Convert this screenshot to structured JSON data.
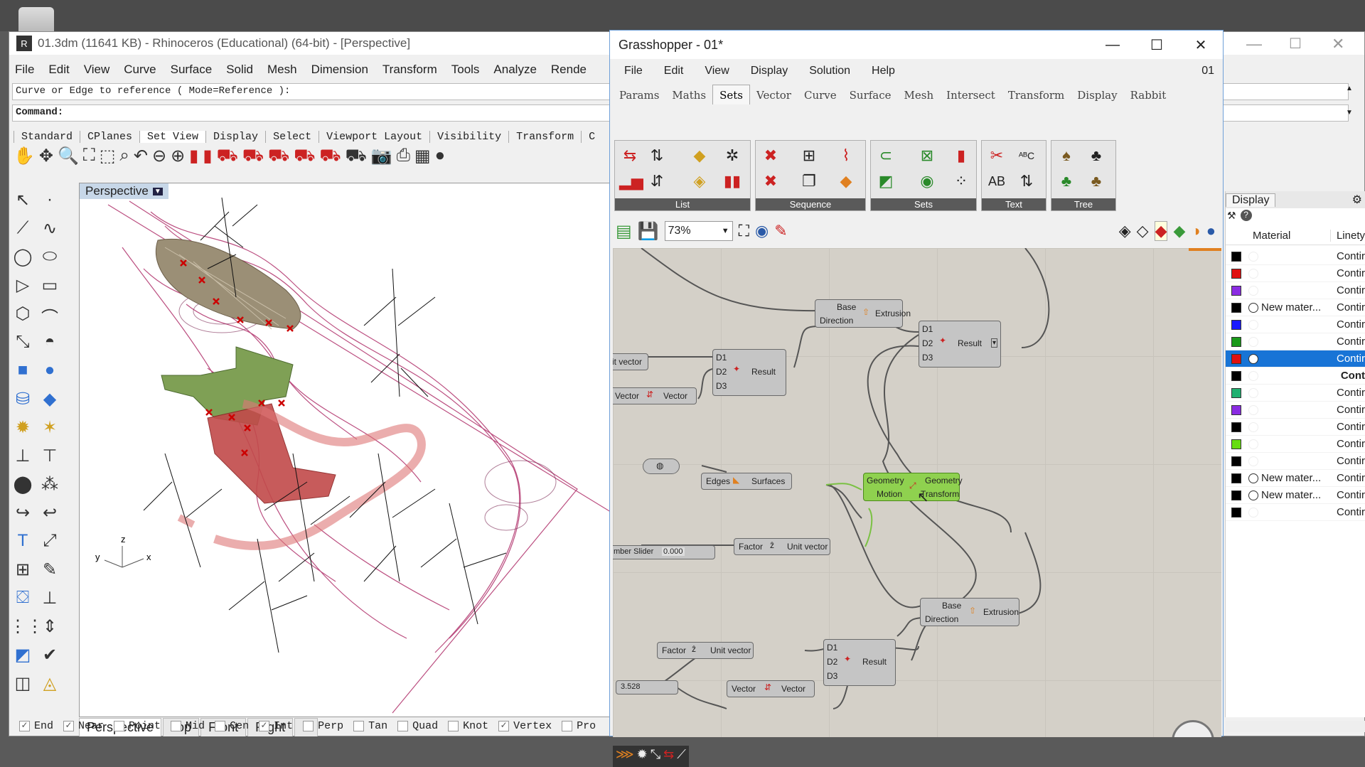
{
  "rhino": {
    "title": "01.3dm (11641 KB) - Rhinoceros (Educational) (64-bit) - [Perspective]",
    "menu": [
      "File",
      "Edit",
      "View",
      "Curve",
      "Surface",
      "Solid",
      "Mesh",
      "Dimension",
      "Transform",
      "Tools",
      "Analyze",
      "Rende"
    ],
    "prompt": "Curve or Edge to reference ( Mode=Reference ):",
    "command_label": "Command:",
    "toolbar_tabs": [
      "Standard",
      "CPlanes",
      "Set View",
      "Display",
      "Select",
      "Viewport Layout",
      "Visibility",
      "Transform",
      "C"
    ],
    "viewport_title": "Perspective",
    "viewport_tabs": [
      "Perspective",
      "Top",
      "Front",
      "Right"
    ],
    "add_tab": "+",
    "axes": {
      "z": "z",
      "y": "y",
      "x": "x"
    },
    "snaps": [
      {
        "label": "End",
        "checked": true
      },
      {
        "label": "Near",
        "checked": true
      },
      {
        "label": "Point",
        "checked": false
      },
      {
        "label": "Mid",
        "checked": false
      },
      {
        "label": "Cen",
        "checked": false
      },
      {
        "label": "Int",
        "checked": true
      },
      {
        "label": "Perp",
        "checked": false
      },
      {
        "label": "Tan",
        "checked": false
      },
      {
        "label": "Quad",
        "checked": false
      },
      {
        "label": "Knot",
        "checked": false
      },
      {
        "label": "Vertex",
        "checked": true
      },
      {
        "label": "Pro",
        "checked": false
      }
    ],
    "layers_panel": {
      "tab": "Display",
      "headers": [
        "Material",
        "Linety"
      ],
      "rows": [
        {
          "color": "#000000",
          "material": "",
          "linetype": "Contir"
        },
        {
          "color": "#e01010",
          "material": "",
          "linetype": "Contir"
        },
        {
          "color": "#8a2be2",
          "material": "",
          "linetype": "Contir"
        },
        {
          "color": "#000000",
          "material": "New mater...",
          "linetype": "Contir"
        },
        {
          "color": "#1a1aff",
          "material": "",
          "linetype": "Contir"
        },
        {
          "color": "#1a9a1a",
          "material": "",
          "linetype": "Contir"
        },
        {
          "color": "#e01010",
          "material": "",
          "linetype": "Contir",
          "selected": true
        },
        {
          "color": "#000000",
          "material": "",
          "linetype": "Cont",
          "bold": true
        },
        {
          "color": "#20b070",
          "material": "",
          "linetype": "Contir"
        },
        {
          "color": "#8a2be2",
          "material": "",
          "linetype": "Contir"
        },
        {
          "color": "#000000",
          "material": "",
          "linetype": "Contir"
        },
        {
          "color": "#66dd11",
          "material": "",
          "linetype": "Contir"
        },
        {
          "color": "#000000",
          "material": "",
          "linetype": "Contir"
        },
        {
          "color": "#000000",
          "material": "New mater...",
          "linetype": "Contir"
        },
        {
          "color": "#000000",
          "material": "New mater...",
          "linetype": "Contir"
        },
        {
          "color": "#000000",
          "material": "",
          "linetype": "Contir"
        }
      ]
    }
  },
  "gh": {
    "title": "Grasshopper - 01*",
    "menu": [
      "File",
      "Edit",
      "View",
      "Display",
      "Solution",
      "Help"
    ],
    "doc_label": "01",
    "tabs": [
      "Params",
      "Maths",
      "Sets",
      "Vector",
      "Curve",
      "Surface",
      "Mesh",
      "Intersect",
      "Transform",
      "Display",
      "Rabbit"
    ],
    "active_tab": "Sets",
    "panels": [
      "List",
      "Sequence",
      "Sets",
      "Text",
      "Tree"
    ],
    "zoom": "73%",
    "nodes": {
      "extrusion1": {
        "in1": "Base",
        "in2": "Direction",
        "name": "Extrusion"
      },
      "merge1": {
        "d1": "D1",
        "d2": "D2",
        "d3": "D3",
        "name": "Result"
      },
      "merge2": {
        "d1": "D1",
        "d2": "D2",
        "d3": "D3",
        "name": "Result"
      },
      "unitvec_top": {
        "label": "it vector"
      },
      "vector1": {
        "in": "Vector",
        "out": "Vector"
      },
      "edges": {
        "in": "Edges",
        "out": "Surfaces"
      },
      "morph": {
        "in1": "Geometry",
        "in2": "Motion",
        "out1": "Geometry",
        "out2": "Transform"
      },
      "slider1": {
        "label": "mber Slider",
        "value": "0.000"
      },
      "unitvec2": {
        "in": "Factor",
        "out": "Unit vector"
      },
      "extrusion2": {
        "in1": "Base",
        "in2": "Direction",
        "name": "Extrusion"
      },
      "unitvec3": {
        "in": "Factor",
        "out": "Unit vector"
      },
      "slider2": {
        "value": "3.528"
      },
      "vector2": {
        "in": "Vector",
        "out": "Vector"
      },
      "merge3": {
        "d1": "D1",
        "d2": "D2",
        "d3": "D3",
        "name": "Result"
      }
    }
  }
}
